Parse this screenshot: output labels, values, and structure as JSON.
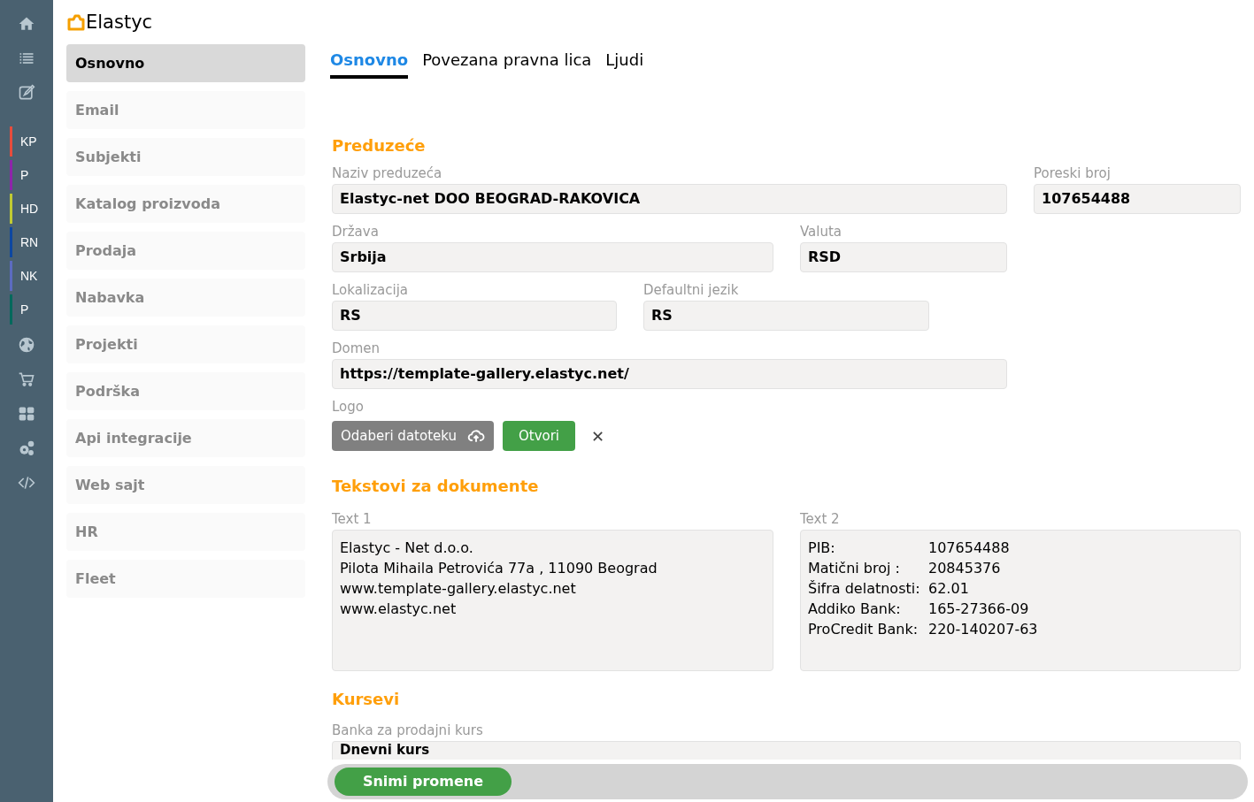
{
  "rail": [
    {
      "kind": "icon"
    },
    {
      "kind": "icon"
    },
    {
      "kind": "icon"
    },
    {
      "kind": "badge",
      "label": "KP",
      "color": "#e74c3c"
    },
    {
      "kind": "badge",
      "label": "P",
      "color": "#8e24aa"
    },
    {
      "kind": "badge",
      "label": "HD",
      "color": "#c0ca33"
    },
    {
      "kind": "badge",
      "label": "RN",
      "color": "#0d47a1"
    },
    {
      "kind": "badge",
      "label": "NK",
      "color": "#5c6bc0"
    },
    {
      "kind": "badge",
      "label": "P",
      "color": "#00695c"
    },
    {
      "kind": "icon"
    },
    {
      "kind": "icon"
    },
    {
      "kind": "icon"
    },
    {
      "kind": "icon"
    },
    {
      "kind": "icon"
    }
  ],
  "logo": "Elastyc",
  "menu": [
    {
      "label": "Osnovno",
      "selected": true
    },
    {
      "label": "Email",
      "selected": false
    },
    {
      "label": "Subjekti",
      "selected": false
    },
    {
      "label": "Katalog proizvoda",
      "selected": false
    },
    {
      "label": "Prodaja",
      "selected": false
    },
    {
      "label": "Nabavka",
      "selected": false
    },
    {
      "label": "Projekti",
      "selected": false
    },
    {
      "label": "Podrška",
      "selected": false
    },
    {
      "label": "Api integracije",
      "selected": false
    },
    {
      "label": "Web sajt",
      "selected": false
    },
    {
      "label": "HR",
      "selected": false
    },
    {
      "label": "Fleet",
      "selected": false
    }
  ],
  "tabs": [
    {
      "label": "Osnovno",
      "selected": true
    },
    {
      "label": "Povezana pravna lica",
      "selected": false
    },
    {
      "label": "Ljudi",
      "selected": false
    }
  ],
  "company": {
    "title": "Preduzeće",
    "name": {
      "label": "Naziv preduzeća",
      "value": "Elastyc-net DOO BEOGRAD-RAKOVICA"
    },
    "tax": {
      "label": "Poreski broj",
      "value": "107654488"
    },
    "country": {
      "label": "Država",
      "value": "Srbija"
    },
    "currency": {
      "label": "Valuta",
      "value": "RSD"
    },
    "locale": {
      "label": "Lokalizacija",
      "value": "RS"
    },
    "language": {
      "label": "Defaultni jezik",
      "value": "RS"
    },
    "domain": {
      "label": "Domen",
      "value": "https://template-gallery.elastyc.net/"
    },
    "logo": {
      "label": "Logo",
      "choose": "Odaberi datoteku",
      "open": "Otvori",
      "remove": "✕"
    }
  },
  "documents": {
    "title": "Tekstovi za dokumente",
    "text1": {
      "label": "Text 1",
      "lines": [
        "Elastyc - Net d.o.o.",
        "Pilota Mihaila Petrovića 77a , 11090 Beograd",
        "www.template-gallery.elastyc.net",
        "www.elastyc.net"
      ]
    },
    "text2": {
      "label": "Text 2",
      "rows": [
        {
          "key": "PIB:",
          "value": "107654488"
        },
        {
          "key": "Matični broj :",
          "value": "20845376"
        },
        {
          "key": "Šifra delatnosti:",
          "value": "62.01"
        },
        {
          "key": "Addiko Bank:",
          "value": "165-27366-09"
        },
        {
          "key": "ProCredit Bank:",
          "value": "220-140207-63"
        }
      ]
    }
  },
  "rates": {
    "title": "Kursevi",
    "bank": {
      "label": "Banka za prodajni kurs",
      "value": "Dnevni kurs"
    }
  },
  "save": "Snimi promene"
}
